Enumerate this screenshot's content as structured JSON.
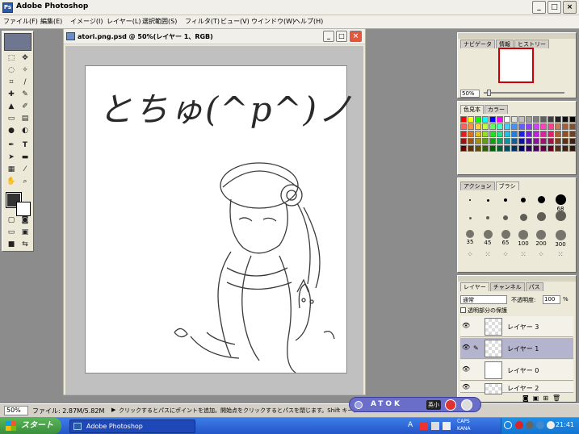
{
  "app": {
    "title": "Adobe Photoshop"
  },
  "menu": [
    "ファイル(F)",
    "編集(E)",
    "イメージ(I)",
    "レイヤー(L)",
    "選択範囲(S)",
    "フィルタ(T)",
    "ビュー(V)",
    "ウインドウ(W)",
    "ヘルプ(H)"
  ],
  "document": {
    "title": "atori.png.psd @ 50%(レイヤー 1、RGB)"
  },
  "canvas_text": "とちゅ(^p^)ノ",
  "navigator": {
    "tabs": [
      "ナビゲータ",
      "情報",
      "ヒストリー"
    ],
    "zoom": "50%"
  },
  "swatches": {
    "tabs": [
      "色見本",
      "カラー"
    ],
    "colors": [
      "#ff0000",
      "#ffff00",
      "#00ff00",
      "#00ffff",
      "#0000ff",
      "#ff00ff",
      "#ffffff",
      "#e0e0e0",
      "#c0c0c0",
      "#a0a0a0",
      "#808080",
      "#606060",
      "#404040",
      "#202020",
      "#101010",
      "#000000",
      "#ff6060",
      "#ff9040",
      "#ffd040",
      "#c0ff40",
      "#60ff60",
      "#40ffc0",
      "#40d0ff",
      "#4090ff",
      "#6060ff",
      "#9040ff",
      "#d040ff",
      "#ff40c0",
      "#ff4090",
      "#c08060",
      "#a06040",
      "#805030",
      "#e02020",
      "#e07020",
      "#e0c020",
      "#90e020",
      "#20e020",
      "#20e090",
      "#20c0e0",
      "#2080e0",
      "#2020e0",
      "#7020e0",
      "#c020e0",
      "#e020a0",
      "#e02070",
      "#b06030",
      "#905020",
      "#704020",
      "#a01010",
      "#a05010",
      "#a09010",
      "#60a010",
      "#10a010",
      "#10a060",
      "#1090a0",
      "#1060a0",
      "#1010a0",
      "#5010a0",
      "#9010a0",
      "#a01070",
      "#a01050",
      "#804020",
      "#603010",
      "#402010",
      "#600000",
      "#603000",
      "#605000",
      "#306000",
      "#006000",
      "#006030",
      "#005060",
      "#003060",
      "#000060",
      "#300060",
      "#500060",
      "#600040",
      "#600020",
      "#503018",
      "#402010",
      "#301808"
    ]
  },
  "brushes": {
    "tabs": [
      "アクション",
      "ブラシ"
    ],
    "labels": [
      "68",
      "35",
      "45",
      "65",
      "100",
      "200",
      "300"
    ]
  },
  "layers": {
    "tabs": [
      "レイヤー",
      "チャンネル",
      "パス"
    ],
    "mode": "通常",
    "opacity_label": "不透明度:",
    "opacity": "100",
    "opacity_unit": "%",
    "lock_label": "透明部分の保護",
    "items": [
      {
        "name": "レイヤー 3"
      },
      {
        "name": "レイヤー 1"
      },
      {
        "name": "レイヤー 0"
      },
      {
        "name": "レイヤー 2"
      }
    ]
  },
  "status": {
    "zoom": "50%",
    "file": "ファイル: 2.87M/5.82M",
    "message": "クリックするとパスにポイントを追加。開始点をクリックするとパスを閉じます。Shift キー、"
  },
  "atok": {
    "label": "ATOK",
    "mode": "英小"
  },
  "taskbar": {
    "start": "スタート",
    "item": "Adobe Photoshop",
    "clock": "21:41",
    "caps": "CAPS",
    "kana": "KANA"
  }
}
